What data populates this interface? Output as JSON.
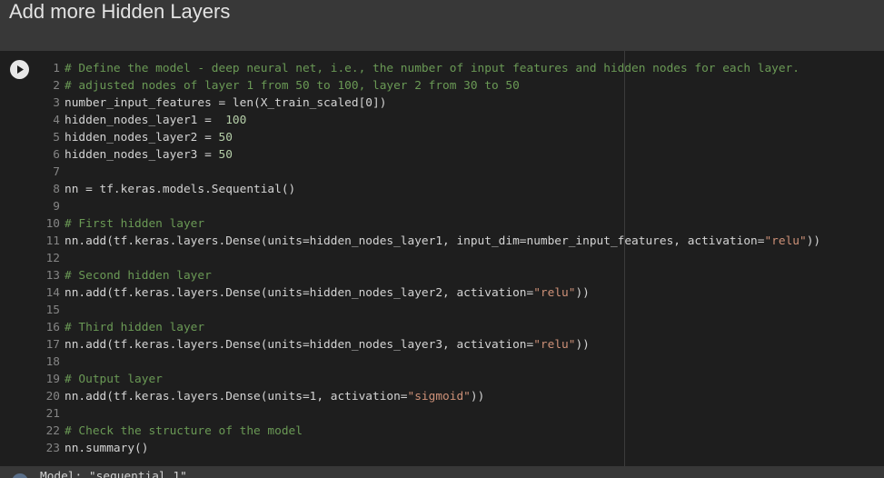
{
  "header": {
    "title": "Add more Hidden Layers"
  },
  "cell": {
    "run_icon": "play-icon",
    "lines": [
      {
        "num": "1",
        "tokens": [
          {
            "t": "comment",
            "v": "# Define the model - deep neural net, i.e., the number of input features and hidden nodes for each layer."
          }
        ]
      },
      {
        "num": "2",
        "tokens": [
          {
            "t": "comment",
            "v": "# adjusted nodes of layer 1 from 50 to 100, layer 2 from 30 to 50"
          }
        ]
      },
      {
        "num": "3",
        "tokens": [
          {
            "t": "plain",
            "v": "number_input_features = len(X_train_scaled[0])"
          }
        ]
      },
      {
        "num": "4",
        "tokens": [
          {
            "t": "plain",
            "v": "hidden_nodes_layer1 =  "
          },
          {
            "t": "number",
            "v": "100"
          }
        ]
      },
      {
        "num": "5",
        "tokens": [
          {
            "t": "plain",
            "v": "hidden_nodes_layer2 = "
          },
          {
            "t": "number",
            "v": "50"
          }
        ]
      },
      {
        "num": "6",
        "tokens": [
          {
            "t": "plain",
            "v": "hidden_nodes_layer3 = "
          },
          {
            "t": "number",
            "v": "50"
          }
        ]
      },
      {
        "num": "7",
        "tokens": []
      },
      {
        "num": "8",
        "tokens": [
          {
            "t": "plain",
            "v": "nn = tf.keras.models.Sequential()"
          }
        ]
      },
      {
        "num": "9",
        "tokens": []
      },
      {
        "num": "10",
        "tokens": [
          {
            "t": "comment",
            "v": "# First hidden layer"
          }
        ]
      },
      {
        "num": "11",
        "tokens": [
          {
            "t": "plain",
            "v": "nn.add(tf.keras.layers.Dense(units=hidden_nodes_layer1, input_dim=number_input_features, activation="
          },
          {
            "t": "string",
            "v": "\"relu\""
          },
          {
            "t": "plain",
            "v": "))"
          }
        ]
      },
      {
        "num": "12",
        "tokens": []
      },
      {
        "num": "13",
        "tokens": [
          {
            "t": "comment",
            "v": "# Second hidden layer"
          }
        ]
      },
      {
        "num": "14",
        "tokens": [
          {
            "t": "plain",
            "v": "nn.add(tf.keras.layers.Dense(units=hidden_nodes_layer2, activation="
          },
          {
            "t": "string",
            "v": "\"relu\""
          },
          {
            "t": "plain",
            "v": "))"
          }
        ]
      },
      {
        "num": "15",
        "tokens": []
      },
      {
        "num": "16",
        "tokens": [
          {
            "t": "comment",
            "v": "# Third hidden layer"
          }
        ]
      },
      {
        "num": "17",
        "tokens": [
          {
            "t": "plain",
            "v": "nn.add(tf.keras.layers.Dense(units=hidden_nodes_layer3, activation="
          },
          {
            "t": "string",
            "v": "\"relu\""
          },
          {
            "t": "plain",
            "v": "))"
          }
        ]
      },
      {
        "num": "18",
        "tokens": []
      },
      {
        "num": "19",
        "tokens": [
          {
            "t": "comment",
            "v": "# Output layer"
          }
        ]
      },
      {
        "num": "20",
        "tokens": [
          {
            "t": "plain",
            "v": "nn.add(tf.keras.layers.Dense(units=1, activation="
          },
          {
            "t": "string",
            "v": "\"sigmoid\""
          },
          {
            "t": "plain",
            "v": "))"
          }
        ]
      },
      {
        "num": "21",
        "tokens": []
      },
      {
        "num": "22",
        "tokens": [
          {
            "t": "comment",
            "v": "# Check the structure of the model"
          }
        ]
      },
      {
        "num": "23",
        "tokens": [
          {
            "t": "plain",
            "v": "nn.summary()"
          }
        ]
      }
    ]
  },
  "output": {
    "icon": "output-icon",
    "partial_text": "Model: \"sequential_1\""
  },
  "colors": {
    "comment": "#6a9955",
    "string": "#ce9178",
    "number": "#b5cea8",
    "plain": "#d4d4d4",
    "line_number": "#858585",
    "cell_bg": "#1e1e1e",
    "page_bg": "#383838"
  }
}
